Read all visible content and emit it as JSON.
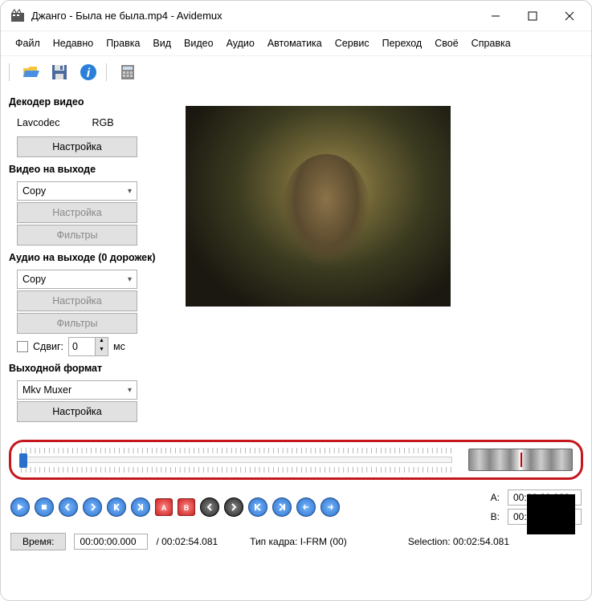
{
  "title": "Джанго - Была не была.mp4 - Avidemux",
  "menu": [
    "Файл",
    "Недавно",
    "Правка",
    "Вид",
    "Видео",
    "Аудио",
    "Автоматика",
    "Сервис",
    "Переход",
    "Своё",
    "Справка"
  ],
  "sections": {
    "decoder_title": "Декодер видео",
    "decoder_lavcodec": "Lavcodec",
    "decoder_rgb": "RGB",
    "decoder_config": "Настройка",
    "video_out_title": "Видео на выходе",
    "video_out_sel": "Copy",
    "video_out_config": "Настройка",
    "video_out_filters": "Фильтры",
    "audio_out_title": "Аудио на выходе (0 дорожек)",
    "audio_out_sel": "Copy",
    "audio_out_config": "Настройка",
    "audio_out_filters": "Фильтры",
    "shift_label": "Сдвиг:",
    "shift_value": "0",
    "shift_unit": "мс",
    "format_title": "Выходной формат",
    "format_sel": "Mkv Muxer",
    "format_config": "Настройка"
  },
  "markers": {
    "a_label": "A:",
    "a_val": "00:00:00.000",
    "b_label": "B:",
    "b_val": "00:02:54.081",
    "sel_label": "Selection:",
    "sel_val": "00:02:54.081"
  },
  "bottom": {
    "time_label": "Время:",
    "time_val": "00:00:00.000",
    "duration": "/ 00:02:54.081",
    "frame_type": "Тип кадра:  I-FRM (00)"
  }
}
